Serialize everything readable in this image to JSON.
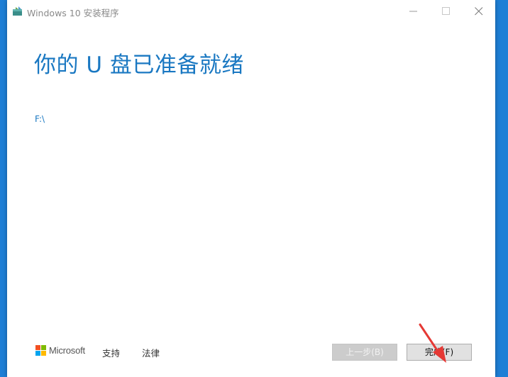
{
  "window": {
    "title": "Windows 10 安装程序"
  },
  "main": {
    "heading": "你的 U 盘已准备就绪",
    "drive": "F:\\"
  },
  "footer": {
    "brand": "Microsoft",
    "support_link": "支持",
    "legal_link": "法律",
    "back_button": "上一步(B)",
    "finish_button": "完成(F)"
  },
  "colors": {
    "accent_text": "#1a78c2",
    "desktop_bg": "#1e7fd6",
    "annotation_arrow": "#e53935",
    "ms_red": "#f25022",
    "ms_green": "#7fba00",
    "ms_blue": "#00a4ef",
    "ms_yellow": "#ffb900"
  },
  "icons": {
    "app": "setup-app-icon",
    "minimize": "minimize-icon",
    "maximize": "maximize-icon",
    "close": "close-icon",
    "logo": "microsoft-logo-icon",
    "annotation": "red-arrow-annotation"
  }
}
